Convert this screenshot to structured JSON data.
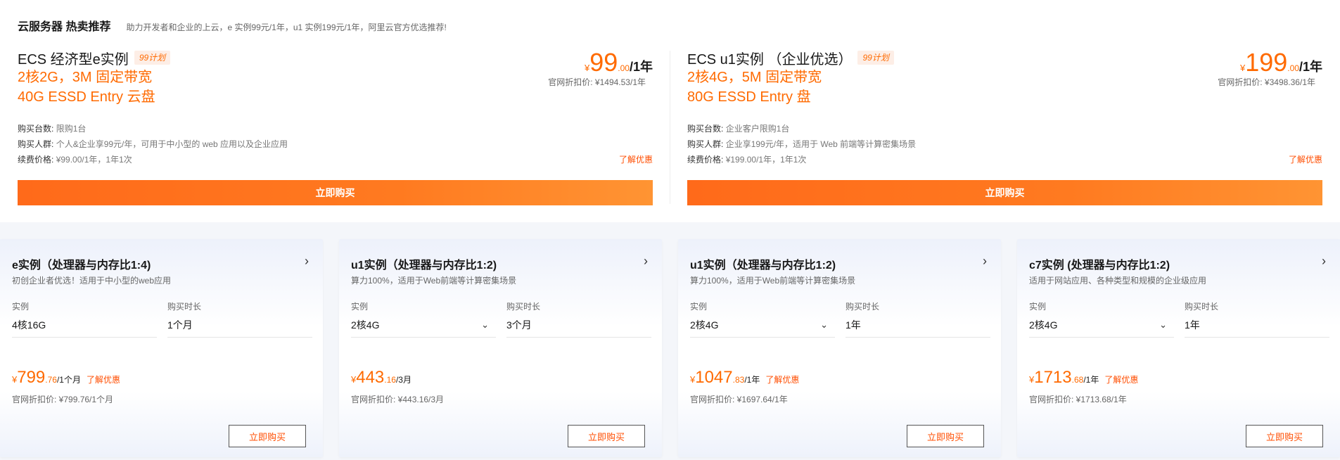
{
  "header": {
    "title": "云服务器 热卖推荐",
    "subtitle": "助力开发者和企业的上云，e 实例99元/1年，u1 实例199元/1年，阿里云官方优选推荐!"
  },
  "promos": [
    {
      "name": "ECS 经济型e实例",
      "tag": "99计划",
      "spec1": "2核2G，3M 固定带宽",
      "spec2": "40G ESSD Entry 云盘",
      "price": {
        "currency": "¥",
        "int": "99",
        "dec": ".00",
        "unit": "/1年"
      },
      "orig": "官网折扣价: ¥1494.53/1年",
      "info": [
        {
          "label": "购买台数:",
          "value": "限购1台"
        },
        {
          "label": "购买人群:",
          "value": "个人&企业享99元/年，可用于中小型的 web 应用以及企业应用"
        },
        {
          "label": "续费价格:",
          "value": "¥99.00/1年，1年1次"
        }
      ],
      "deal": "了解优惠",
      "buy": "立即购买"
    },
    {
      "name": "ECS u1实例 （企业优选）",
      "tag": "99计划",
      "spec1": "2核4G，5M 固定带宽",
      "spec2": "80G ESSD Entry 盘",
      "price": {
        "currency": "¥",
        "int": "199",
        "dec": ".00",
        "unit": "/1年"
      },
      "orig": "官网折扣价: ¥3498.36/1年",
      "info": [
        {
          "label": "购买台数:",
          "value": "企业客户限购1台"
        },
        {
          "label": "购买人群:",
          "value": "企业享199元/年，适用于 Web 前端等计算密集场景"
        },
        {
          "label": "续费价格:",
          "value": "¥199.00/1年，1年1次"
        }
      ],
      "deal": "了解优惠",
      "buy": "立即购买"
    }
  ],
  "cards": [
    {
      "title": "e实例（处理器与内存比1:4)",
      "desc": "初创企业者优选！适用于中小型的web应用",
      "instance_label": "实例",
      "instance_value": "4核16G",
      "instance_dropdown": false,
      "duration_label": "购买时长",
      "duration_value": "1个月",
      "price": {
        "currency": "¥",
        "int": "799",
        "dec": ".76",
        "unit": "/1个月"
      },
      "deal": "了解优惠",
      "orig": "官网折扣价: ¥799.76/1个月",
      "buy": "立即购买"
    },
    {
      "title": "u1实例（处理器与内存比1:2)",
      "desc": "算力100%，适用于Web前端等计算密集场景",
      "instance_label": "实例",
      "instance_value": "2核4G",
      "instance_dropdown": true,
      "duration_label": "购买时长",
      "duration_value": "3个月",
      "price": {
        "currency": "¥",
        "int": "443",
        "dec": ".16",
        "unit": "/3月"
      },
      "deal": "",
      "orig": "官网折扣价: ¥443.16/3月",
      "buy": "立即购买"
    },
    {
      "title": "u1实例（处理器与内存比1:2)",
      "desc": "算力100%，适用于Web前端等计算密集场景",
      "instance_label": "实例",
      "instance_value": "2核4G",
      "instance_dropdown": true,
      "duration_label": "购买时长",
      "duration_value": "1年",
      "price": {
        "currency": "¥",
        "int": "1047",
        "dec": ".83",
        "unit": "/1年"
      },
      "deal": "了解优惠",
      "orig": "官网折扣价: ¥1697.64/1年",
      "buy": "立即购买"
    },
    {
      "title": "c7实例 (处理器与内存比1:2)",
      "desc": "适用于网站应用、各种类型和规模的企业级应用",
      "instance_label": "实例",
      "instance_value": "2核4G",
      "instance_dropdown": true,
      "duration_label": "购买时长",
      "duration_value": "1年",
      "price": {
        "currency": "¥",
        "int": "1713",
        "dec": ".68",
        "unit": "/1年"
      },
      "deal": "了解优惠",
      "orig": "官网折扣价: ¥1713.68/1年",
      "buy": "立即购买"
    }
  ],
  "colors": {
    "accent": "#ff6a00",
    "link": "#ff4d00",
    "text": "#181818"
  },
  "icons": {
    "card_arrow": "chevron-right-icon",
    "dropdown": "chevron-down-icon"
  }
}
